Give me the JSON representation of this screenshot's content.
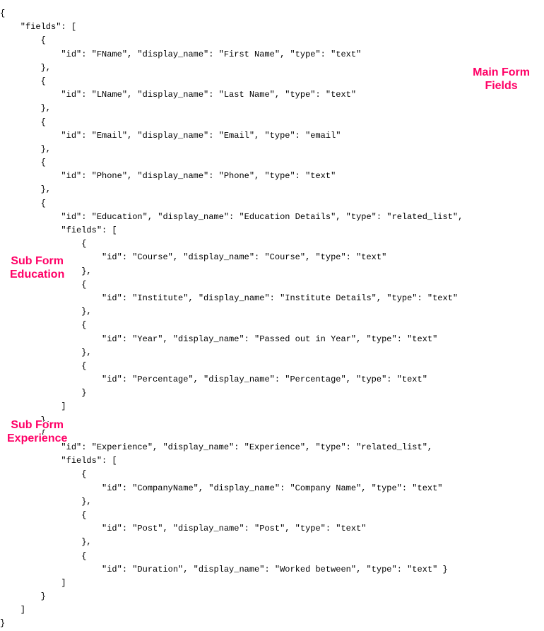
{
  "annotations": {
    "main": "Main Form\nFields",
    "education": "Sub Form\nEducation",
    "experience": "Sub Form\nExperience"
  },
  "code_lines": {
    "l0": "{",
    "l1": "    \"fields\": [",
    "l2": "        {",
    "l3": "            \"id\": \"FName\", \"display_name\": \"First Name\", \"type\": \"text\"",
    "l4": "        },",
    "l5": "        {",
    "l6": "            \"id\": \"LName\", \"display_name\": \"Last Name\", \"type\": \"text\"",
    "l7": "        },",
    "l8": "        {",
    "l9": "            \"id\": \"Email\", \"display_name\": \"Email\", \"type\": \"email\"",
    "l10": "        },",
    "l11": "        {",
    "l12": "            \"id\": \"Phone\", \"display_name\": \"Phone\", \"type\": \"text\"",
    "l13": "        },",
    "l14": "        {",
    "l15": "            \"id\": \"Education\", \"display_name\": \"Education Details\", \"type\": \"related_list\",",
    "l16": "            \"fields\": [",
    "l17": "                {",
    "l18": "                    \"id\": \"Course\", \"display_name\": \"Course\", \"type\": \"text\"",
    "l19": "                },",
    "l20": "                {",
    "l21": "                    \"id\": \"Institute\", \"display_name\": \"Institute Details\", \"type\": \"text\"",
    "l22": "                },",
    "l23": "                {",
    "l24": "                    \"id\": \"Year\", \"display_name\": \"Passed out in Year\", \"type\": \"text\"",
    "l25": "                },",
    "l26": "                {",
    "l27": "                    \"id\": \"Percentage\", \"display_name\": \"Percentage\", \"type\": \"text\"",
    "l28": "                }",
    "l29": "            ]",
    "l30": "        },",
    "l31": "        {",
    "l32": "            \"id\": \"Experience\", \"display_name\": \"Experience\", \"type\": \"related_list\",",
    "l33": "            \"fields\": [",
    "l34": "                {",
    "l35": "                    \"id\": \"CompanyName\", \"display_name\": \"Company Name\", \"type\": \"text\"",
    "l36": "                },",
    "l37": "                {",
    "l38": "                    \"id\": \"Post\", \"display_name\": \"Post\", \"type\": \"text\"",
    "l39": "                },",
    "l40": "                {",
    "l41": "                    \"id\": \"Duration\", \"display_name\": \"Worked between\", \"type\": \"text\" }",
    "l42": "            ]",
    "l43": "        }",
    "l44": "    ]",
    "l45": "}"
  }
}
